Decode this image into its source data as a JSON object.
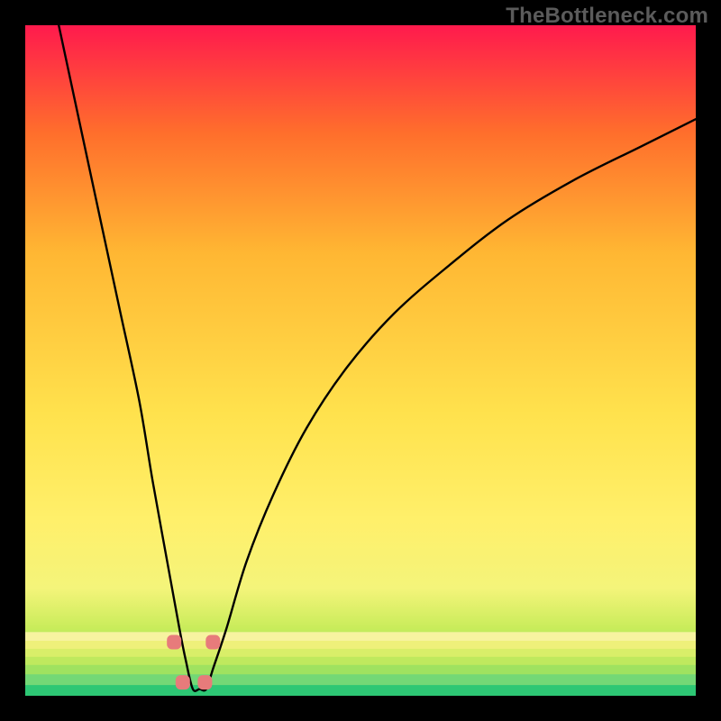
{
  "watermark": "TheBottleneck.com",
  "chart_data": {
    "type": "line",
    "title": "",
    "xlabel": "",
    "ylabel": "",
    "xlim": [
      0,
      100
    ],
    "ylim": [
      0,
      100
    ],
    "legend": false,
    "grid": false,
    "background_gradient_colors_top_to_bottom": [
      "#ff1a4d",
      "#ff6e2c",
      "#ffb733",
      "#ffe24d",
      "#fff06b",
      "#f4f47a",
      "#c8ec5a",
      "#74dd7a",
      "#29c876"
    ],
    "curve": {
      "name": "bottleneck curve",
      "description": "V-shaped curve; y approx 100 at left edge, drops to ~0 around x=25, rises to approx 85 at right edge",
      "x": [
        5,
        8,
        11,
        14,
        17,
        19,
        21,
        23,
        24,
        25,
        26,
        27,
        28,
        30,
        33,
        37,
        42,
        48,
        55,
        63,
        72,
        82,
        92,
        100
      ],
      "y": [
        100,
        86,
        72,
        58,
        44,
        32,
        21,
        10,
        5,
        1,
        1,
        1,
        4,
        10,
        20,
        30,
        40,
        49,
        57,
        64,
        71,
        77,
        82,
        86
      ]
    },
    "markers": {
      "name": "near-minimum points",
      "description": "rounded pink markers near curve minimum",
      "x": [
        22.2,
        23.5,
        26.8,
        28.0
      ],
      "y": [
        8.0,
        2.0,
        2.0,
        8.0
      ],
      "color": "#e77b7b",
      "marker_radius_px": 8
    },
    "good_band": {
      "description": "green band at bottom of gradient representing optimal / no-bottleneck zone",
      "y_range": [
        0,
        5
      ]
    }
  }
}
